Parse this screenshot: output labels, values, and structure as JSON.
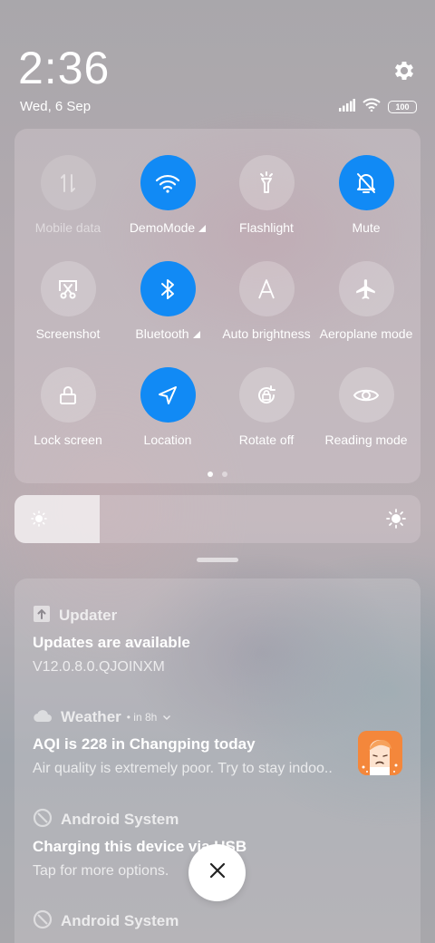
{
  "status": {
    "time": "2:36",
    "date": "Wed, 6 Sep",
    "battery": "100"
  },
  "tiles": [
    {
      "label": "Mobile data",
      "icon": "mobile-data-icon",
      "state": "disabled"
    },
    {
      "label": "DemoMode",
      "icon": "wifi-icon",
      "state": "active",
      "expandable": true
    },
    {
      "label": "Flashlight",
      "icon": "flashlight-icon",
      "state": "inactive"
    },
    {
      "label": "Mute",
      "icon": "mute-bell-icon",
      "state": "active"
    },
    {
      "label": "Screenshot",
      "icon": "screenshot-icon",
      "state": "inactive"
    },
    {
      "label": "Bluetooth",
      "icon": "bluetooth-icon",
      "state": "active",
      "expandable": true
    },
    {
      "label": "Auto brightness",
      "icon": "auto-brightness-icon",
      "state": "inactive"
    },
    {
      "label": "Aeroplane mode",
      "icon": "aeroplane-icon",
      "state": "inactive"
    },
    {
      "label": "Lock screen",
      "icon": "lock-icon",
      "state": "inactive"
    },
    {
      "label": "Location",
      "icon": "location-icon",
      "state": "active"
    },
    {
      "label": "Rotate off",
      "icon": "rotate-icon",
      "state": "inactive"
    },
    {
      "label": "Reading mode",
      "icon": "eye-icon",
      "state": "inactive"
    }
  ],
  "brightness": {
    "level": 0.21
  },
  "notifications": [
    {
      "app": "Updater",
      "meta": "",
      "title": "Updates are available",
      "body": "V12.0.8.0.QJOINXM",
      "icon": "updater-icon"
    },
    {
      "app": "Weather",
      "meta": "• in 8h",
      "title": "AQI is 228 in Changping today",
      "body": "Air quality is extremely poor. Try to stay indoo..",
      "icon": "cloud-icon"
    },
    {
      "app": "Android System",
      "meta": "",
      "title": "Charging this device via USB",
      "body": "Tap for more options.",
      "icon": "android-system-icon"
    },
    {
      "app": "Android System",
      "meta": "",
      "title": "",
      "body": "",
      "icon": "android-system-icon"
    }
  ],
  "colors": {
    "accent": "#118af5"
  }
}
